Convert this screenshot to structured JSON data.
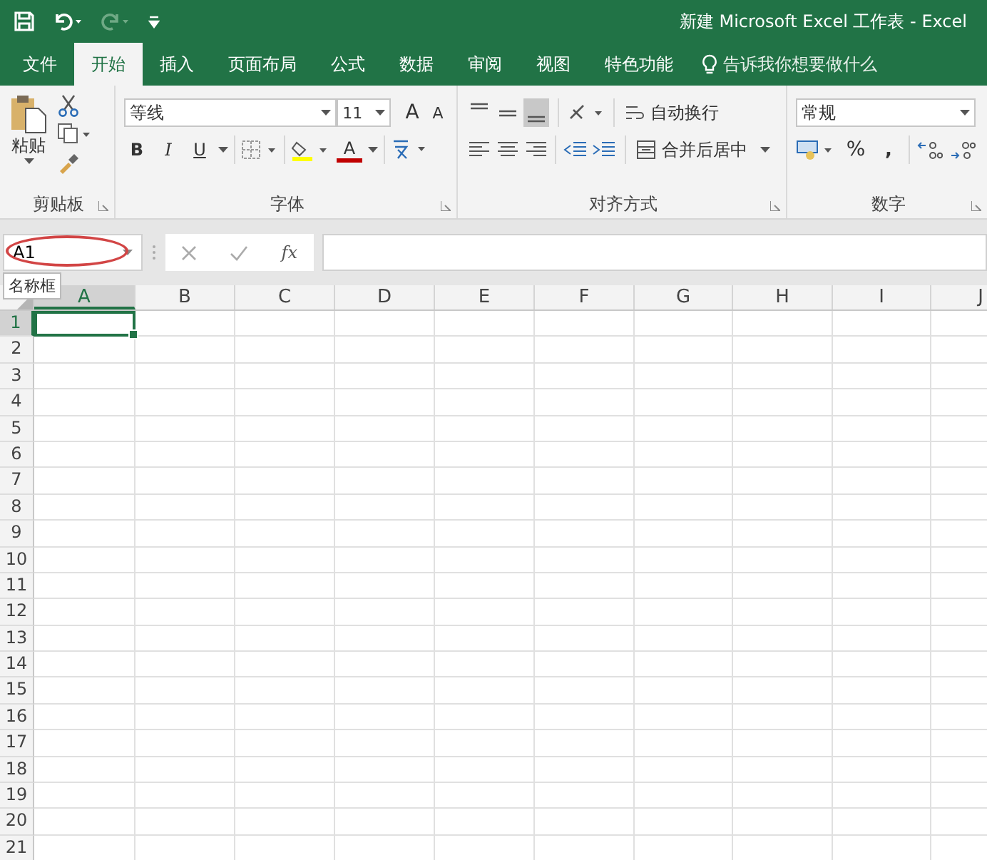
{
  "window": {
    "title": "新建 Microsoft Excel 工作表 - Excel"
  },
  "tabs": [
    {
      "label": "文件",
      "selected": false
    },
    {
      "label": "开始",
      "selected": true
    },
    {
      "label": "插入",
      "selected": false
    },
    {
      "label": "页面布局",
      "selected": false
    },
    {
      "label": "公式",
      "selected": false
    },
    {
      "label": "数据",
      "selected": false
    },
    {
      "label": "审阅",
      "selected": false
    },
    {
      "label": "视图",
      "selected": false
    },
    {
      "label": "特色功能",
      "selected": false
    }
  ],
  "tell_me": {
    "placeholder": "告诉我你想要做什么"
  },
  "ribbon": {
    "clipboard": {
      "label": "剪贴板",
      "paste": "粘贴"
    },
    "font": {
      "label": "字体",
      "font_name": "等线",
      "font_size": "11",
      "grow": "A",
      "shrink": "A",
      "bold": "B",
      "italic": "I",
      "underline": "U",
      "font_color": "A"
    },
    "alignment": {
      "label": "对齐方式",
      "vertical_align": [
        {
          "selected": false
        },
        {
          "selected": false
        },
        {
          "selected": true
        }
      ],
      "wrap_text": "自动换行",
      "merge_center": "合并后居中"
    },
    "number": {
      "label": "数字",
      "format": "常规",
      "percent": "%",
      "comma": ","
    }
  },
  "formula_bar": {
    "name_box": "A1",
    "tooltip": "名称框",
    "function_label": "fx"
  },
  "grid": {
    "columns": [
      {
        "label": "A",
        "selected": true
      },
      {
        "label": "B",
        "selected": false
      },
      {
        "label": "C",
        "selected": false
      },
      {
        "label": "D",
        "selected": false
      },
      {
        "label": "E",
        "selected": false
      },
      {
        "label": "F",
        "selected": false
      },
      {
        "label": "G",
        "selected": false
      },
      {
        "label": "H",
        "selected": false
      },
      {
        "label": "I",
        "selected": false
      },
      {
        "label": "J",
        "selected": false
      }
    ],
    "rows": [
      {
        "label": "1",
        "selected": true
      },
      {
        "label": "2",
        "selected": false
      },
      {
        "label": "3",
        "selected": false
      },
      {
        "label": "4",
        "selected": false
      },
      {
        "label": "5",
        "selected": false
      },
      {
        "label": "6",
        "selected": false
      },
      {
        "label": "7",
        "selected": false
      },
      {
        "label": "8",
        "selected": false
      },
      {
        "label": "9",
        "selected": false
      },
      {
        "label": "10",
        "selected": false
      },
      {
        "label": "11",
        "selected": false
      },
      {
        "label": "12",
        "selected": false
      },
      {
        "label": "13",
        "selected": false
      },
      {
        "label": "14",
        "selected": false
      },
      {
        "label": "15",
        "selected": false
      },
      {
        "label": "16",
        "selected": false
      },
      {
        "label": "17",
        "selected": false
      },
      {
        "label": "18",
        "selected": false
      },
      {
        "label": "19",
        "selected": false
      },
      {
        "label": "20",
        "selected": false
      },
      {
        "label": "21",
        "selected": false
      }
    ]
  }
}
